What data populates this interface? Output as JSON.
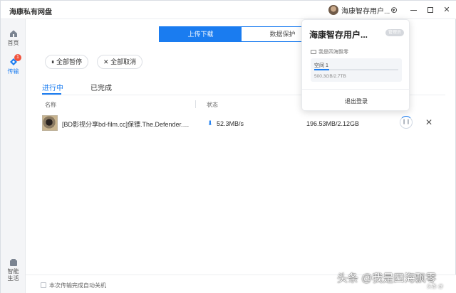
{
  "app": {
    "title": "海康私有网盘"
  },
  "titlebar": {
    "user_name": "海康智存用户..."
  },
  "sidebar": {
    "items": [
      {
        "label": "首页",
        "icon": "home-icon"
      },
      {
        "label": "传输",
        "icon": "transfer-icon",
        "badge": "1",
        "active": true
      },
      {
        "label_line1": "智能",
        "label_line2": "生活",
        "icon": "smart-life-icon"
      }
    ]
  },
  "segment": {
    "tabs": [
      "上传下载",
      "数据保护"
    ],
    "active_index": 0
  },
  "actions": {
    "pause_all": "全部暂停",
    "cancel_all": "全部取消"
  },
  "tabs": {
    "in_progress": "进行中",
    "completed": "已完成"
  },
  "table": {
    "columns": [
      "名称",
      "状态"
    ],
    "rows": [
      {
        "name": "[BD影视分享bd-film.cc]保镖.The.Defender.1994....",
        "speed": "52.3MB/s",
        "size": "196.53MB/2.12GB"
      }
    ]
  },
  "bottom": {
    "auto_shutdown": "本次传输完成自动关机"
  },
  "popup": {
    "user_name": "海康智存用户...",
    "role": "管理员",
    "source": "我是四海飘零",
    "space_label": "空间 1",
    "space_usage": "500.3GB/2.7TB",
    "space_used_fraction": 0.18,
    "logout": "退出登录"
  },
  "watermark": {
    "text": "头条 @我是四海飘零",
    "small": "头条 @"
  },
  "colors": {
    "accent": "#1a7cf0",
    "badge": "#f0533d"
  }
}
